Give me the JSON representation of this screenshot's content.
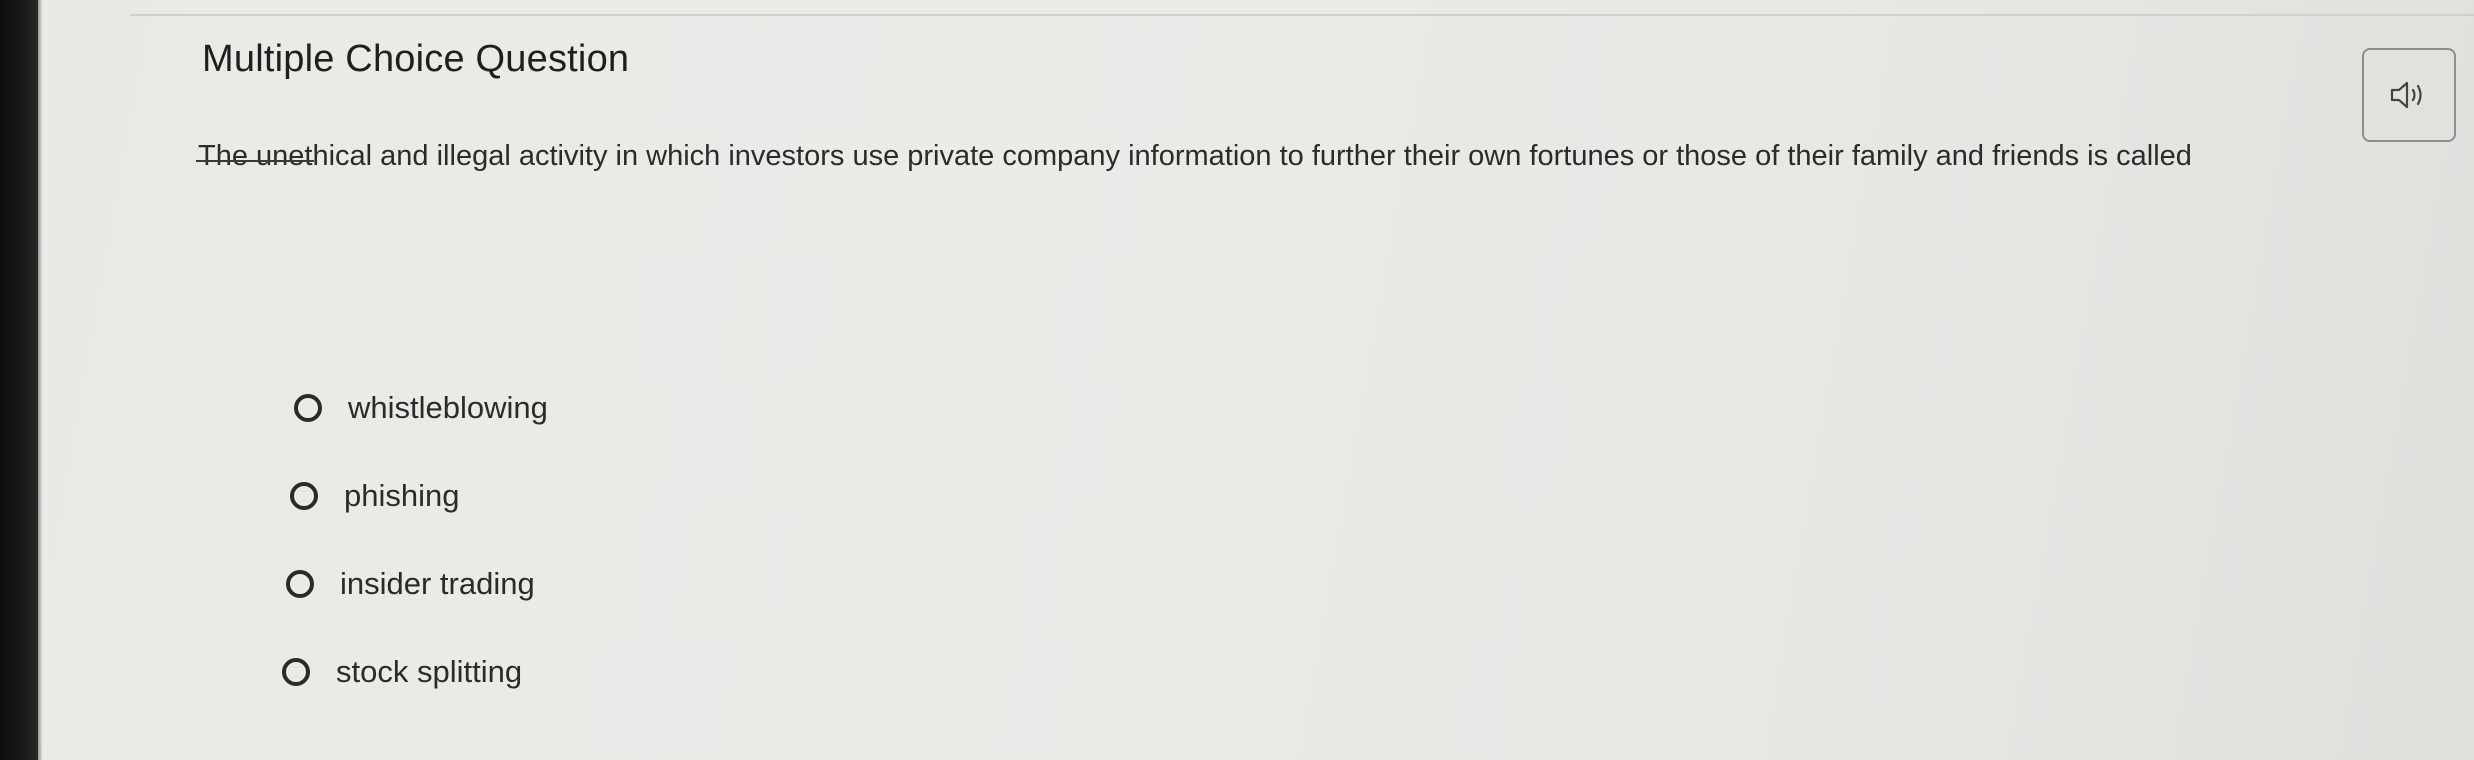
{
  "question": {
    "header": "Multiple Choice Question",
    "prompt": "The unethical and illegal activity in which investors use private company information to further their own fortunes or those of their family and friends is called",
    "audio_icon": "speaker-icon"
  },
  "options": [
    {
      "label": "whistleblowing"
    },
    {
      "label": "phishing"
    },
    {
      "label": "insider trading"
    },
    {
      "label": "stock splitting"
    }
  ]
}
